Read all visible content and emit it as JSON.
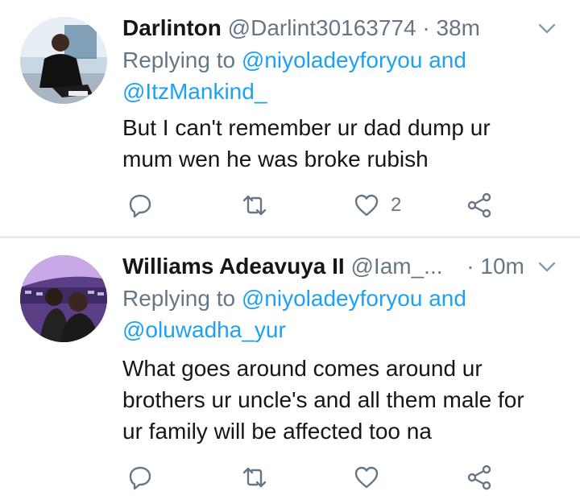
{
  "tweets": [
    {
      "name": "Darlinton",
      "handle": "@Darlint30163774",
      "separator": "·",
      "time": "38m",
      "replying_prefix": "Replying to",
      "replying_user1": "@niyoladeyforyou",
      "replying_and": "and",
      "replying_user2": "@ItzMankind_",
      "text_lines": [
        "But I can't remember ur dad dump ur",
        "mum wen he was broke rubish"
      ],
      "reply_count": "",
      "retweet_count": "",
      "like_count": "2"
    },
    {
      "name": "Williams Adeavuya II",
      "handle": "@Iam_...",
      "separator": "·",
      "time": "10m",
      "replying_prefix": "Replying to",
      "replying_user1": "@niyoladeyforyou",
      "replying_and": "and",
      "replying_user2": "@oluwadha_yur",
      "text_lines": [
        "What goes around comes around ur",
        "brothers ur uncle's and all them male for",
        "ur family will be affected too na"
      ],
      "reply_count": "",
      "retweet_count": "",
      "like_count": ""
    }
  ],
  "icons": {
    "reply": "reply-icon",
    "retweet": "retweet-icon",
    "like": "heart-icon",
    "share": "share-icon",
    "menu": "chevron-down-icon"
  },
  "colors": {
    "link": "#1da1f2",
    "secondary": "#657786",
    "text": "#14171a",
    "divider": "#e6ecf0"
  }
}
